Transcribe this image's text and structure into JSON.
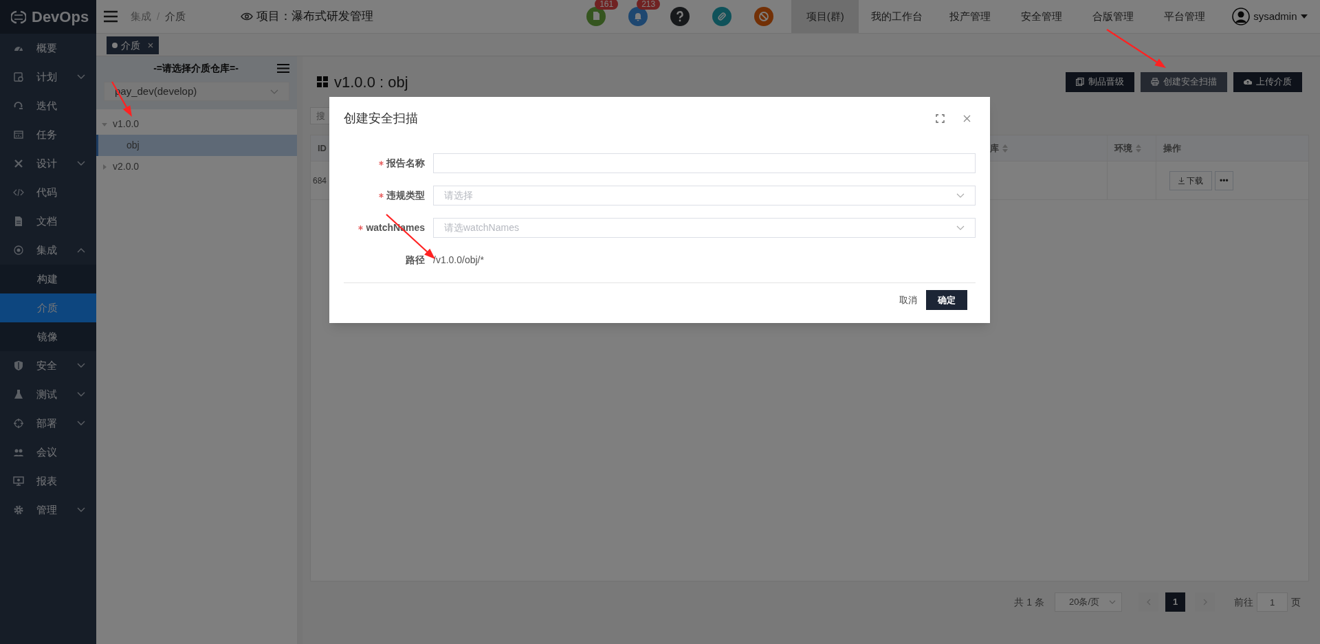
{
  "sidebar": {
    "logo": "DevOps",
    "items": [
      {
        "label": "概要",
        "kind": "link",
        "selected": false
      },
      {
        "label": "计划",
        "kind": "group",
        "expanded": false,
        "selected": false
      },
      {
        "label": "迭代",
        "kind": "link",
        "selected": false
      },
      {
        "label": "任务",
        "kind": "link",
        "selected": false
      },
      {
        "label": "设计",
        "kind": "group",
        "expanded": false,
        "selected": false
      },
      {
        "label": "代码",
        "kind": "link",
        "selected": false
      },
      {
        "label": "文档",
        "kind": "link",
        "selected": false
      },
      {
        "label": "集成",
        "kind": "group",
        "expanded": true,
        "selected": false,
        "children": [
          {
            "label": "构建",
            "selected": false
          },
          {
            "label": "介质",
            "selected": true
          },
          {
            "label": "镜像",
            "selected": false
          }
        ]
      },
      {
        "label": "安全",
        "kind": "group",
        "expanded": false,
        "selected": false
      },
      {
        "label": "测试",
        "kind": "group",
        "expanded": false,
        "selected": false
      },
      {
        "label": "部署",
        "kind": "group",
        "expanded": false,
        "selected": false
      },
      {
        "label": "会议",
        "kind": "link",
        "selected": false
      },
      {
        "label": "报表",
        "kind": "link",
        "selected": false
      },
      {
        "label": "管理",
        "kind": "group",
        "expanded": false,
        "selected": false
      }
    ]
  },
  "header": {
    "breadcrumb": [
      "集成",
      "介质"
    ],
    "breadcrumb_separator": "/",
    "project": "项目：瀑布式研发管理",
    "notification_badges": [
      "161",
      "213"
    ],
    "nav": [
      {
        "label": "项目(群)",
        "selected": true
      },
      {
        "label": "我的工作台",
        "selected": false
      },
      {
        "label": "投产管理",
        "selected": false
      },
      {
        "label": "安全管理",
        "selected": false
      },
      {
        "label": "合版管理",
        "selected": false
      },
      {
        "label": "平台管理",
        "selected": false
      }
    ],
    "user": "sysadmin"
  },
  "tabs": [
    {
      "label": "介质",
      "selected": true
    }
  ],
  "repo_panel": {
    "title": "-=请选择介质仓库=-",
    "repository": "pay_dev(develop)",
    "tree": [
      {
        "label": "v1.0.0",
        "expanded": true,
        "selected": false,
        "children": [
          {
            "label": "obj",
            "selected": true
          }
        ]
      },
      {
        "label": "v2.0.0",
        "expanded": false,
        "selected": false
      }
    ]
  },
  "content": {
    "title": "v1.0.0 : obj",
    "actions": [
      {
        "label": "制品晋级",
        "hovered": false
      },
      {
        "label": "创建安全扫描",
        "hovered": true
      },
      {
        "label": "上传介质",
        "hovered": false
      }
    ],
    "search": {
      "placeholder": "搜"
    },
    "table": {
      "columns": [
        {
          "label": "ID"
        },
        {
          "label": "库",
          "sortable": true
        },
        {
          "label": "环境",
          "sortable": true
        },
        {
          "label": "操作"
        }
      ],
      "rows": [
        {
          "id": "684",
          "actions": [
            "下载",
            "•••"
          ]
        }
      ]
    },
    "pagination": {
      "total": "共 1 条",
      "page_size": "20条/页",
      "pages": [
        {
          "label": "1",
          "selected": true
        }
      ],
      "goto_label": "前往",
      "goto_value": "1",
      "goto_suffix": "页"
    }
  },
  "dialog": {
    "title": "创建安全扫描",
    "fields": [
      {
        "label": "报告名称",
        "required": true,
        "kind": "text"
      },
      {
        "label": "违规类型",
        "required": true,
        "kind": "select",
        "placeholder": "请选择"
      },
      {
        "label": "watchNames",
        "required": true,
        "kind": "select",
        "placeholder": "请选watchNames"
      },
      {
        "label": "路径",
        "required": false,
        "kind": "static",
        "value": "/v1.0.0/obj/*"
      }
    ],
    "buttons": [
      {
        "label": "取消",
        "kind": "text"
      },
      {
        "label": "确定",
        "kind": "primary"
      }
    ]
  }
}
